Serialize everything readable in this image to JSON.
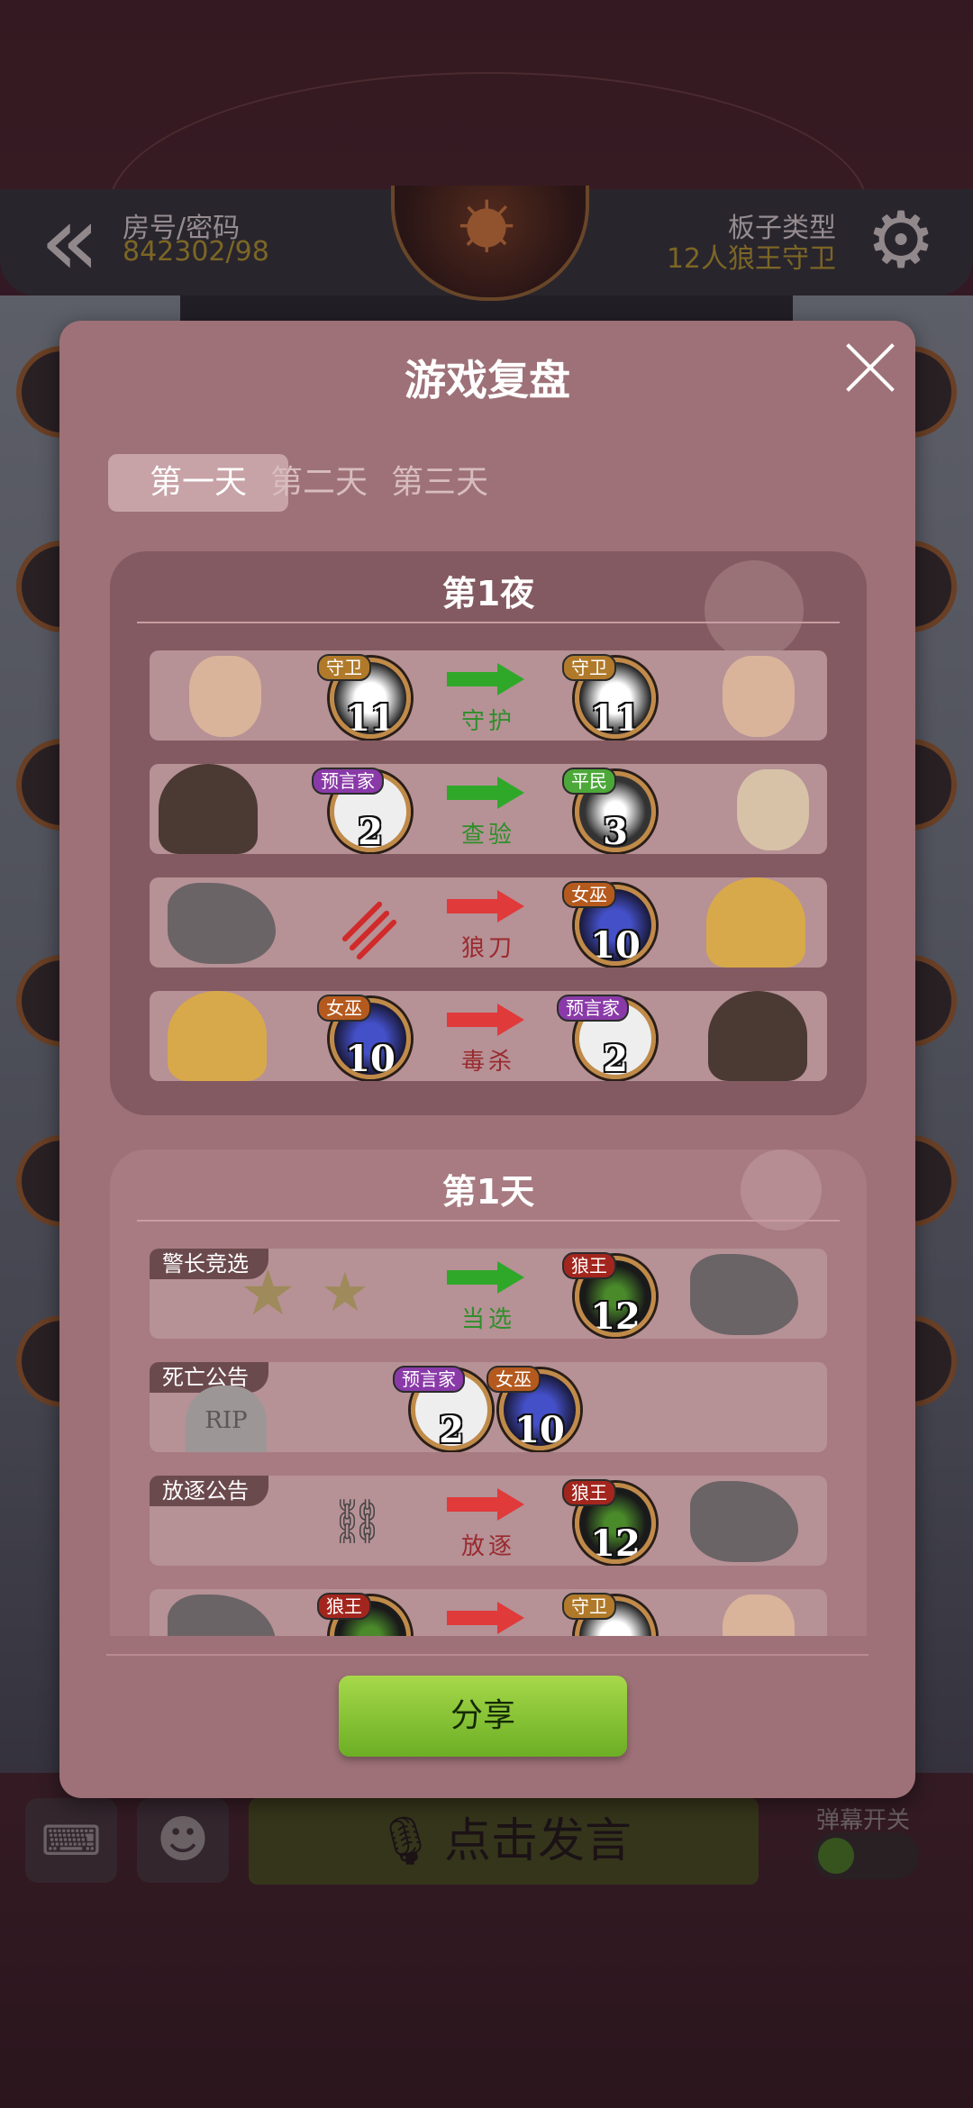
{
  "header": {
    "room_label": "房号/密码",
    "room_value": "842302/98",
    "board_label": "板子类型",
    "board_value": "12人狼王守卫"
  },
  "bottom_bar": {
    "speak_label": "点击发言",
    "danmu_label": "弹幕开关"
  },
  "modal": {
    "title": "游戏复盘",
    "tabs": [
      "第一天",
      "第二天",
      "第三天"
    ],
    "active_tab": 0,
    "night": {
      "title": "第1夜",
      "rows": [
        {
          "from_role": "守卫",
          "from_num": "11",
          "action": "守护",
          "to_role": "守卫",
          "to_num": "11"
        },
        {
          "from_role": "预言家",
          "from_num": "2",
          "action": "查验",
          "to_role": "平民",
          "to_num": "3"
        },
        {
          "action": "狼刀",
          "to_role": "女巫",
          "to_num": "10"
        },
        {
          "from_role": "女巫",
          "from_num": "10",
          "action": "毒杀",
          "to_role": "预言家",
          "to_num": "2"
        }
      ]
    },
    "day": {
      "title": "第1天",
      "rows": [
        {
          "banner": "警长竞选",
          "action": "当选",
          "to_role": "狼王",
          "to_num": "12"
        },
        {
          "banner": "死亡公告",
          "deaths": [
            {
              "role": "预言家",
              "num": "2"
            },
            {
              "role": "女巫",
              "num": "10"
            }
          ],
          "rip": "RIP"
        },
        {
          "banner": "放逐公告",
          "action": "放逐",
          "to_role": "狼王",
          "to_num": "12"
        },
        {
          "from_role": "狼王",
          "to_role": "守卫"
        }
      ]
    },
    "share_label": "分享"
  },
  "colors": {
    "green_action": "#2f8f2a",
    "red_action": "#9a2a2e",
    "tag_guard": "#b07a2a",
    "tag_seer": "#8a3aa8",
    "tag_villager": "#4da83a",
    "tag_witch": "#b55a1e",
    "tag_wolfking": "#a3261e"
  }
}
